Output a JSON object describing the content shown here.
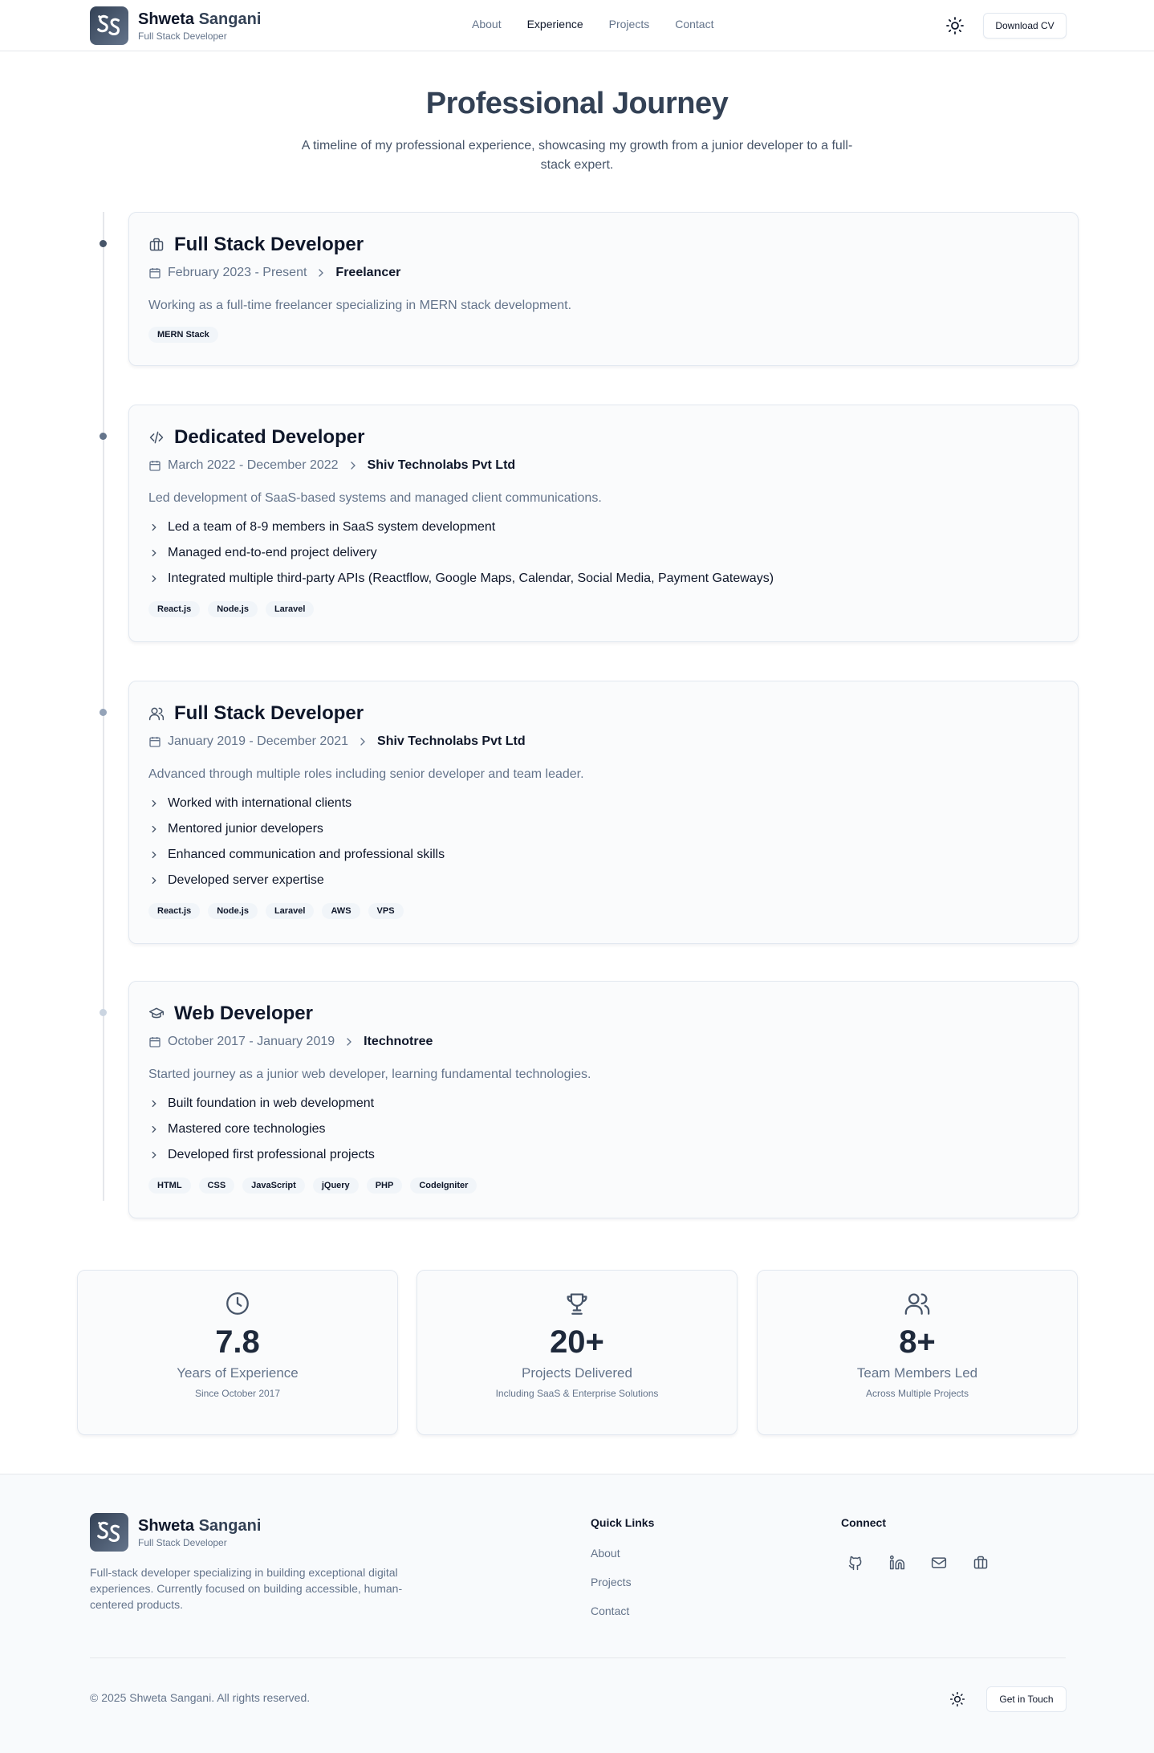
{
  "header": {
    "first_name": "Shweta",
    "last_name": "Sangani",
    "subtitle": "Full Stack Developer",
    "nav": [
      "About",
      "Experience",
      "Projects",
      "Contact"
    ],
    "active_nav": "Experience",
    "download_label": "Download CV"
  },
  "hero": {
    "title": "Professional Journey",
    "subtitle": "A timeline of my professional experience, showcasing my growth from a junior developer to a full-stack expert."
  },
  "experience": [
    {
      "icon": "briefcase-icon",
      "title": "Full Stack Developer",
      "dates": "February 2023 - Present",
      "company": "Freelancer",
      "description": "Working as a full-time freelancer specializing in MERN stack development.",
      "bullets": [],
      "tags": [
        "MERN Stack"
      ]
    },
    {
      "icon": "code-icon",
      "title": "Dedicated Developer",
      "dates": "March 2022 - December 2022",
      "company": "Shiv Technolabs Pvt Ltd",
      "description": "Led development of SaaS-based systems and managed client communications.",
      "bullets": [
        "Led a team of 8-9 members in SaaS system development",
        "Managed end-to-end project delivery",
        "Integrated multiple third-party APIs (Reactflow, Google Maps, Calendar, Social Media, Payment Gateways)"
      ],
      "tags": [
        "React.js",
        "Node.js",
        "Laravel"
      ]
    },
    {
      "icon": "users-icon",
      "title": "Full Stack Developer",
      "dates": "January 2019 - December 2021",
      "company": "Shiv Technolabs Pvt Ltd",
      "description": "Advanced through multiple roles including senior developer and team leader.",
      "bullets": [
        "Worked with international clients",
        "Mentored junior developers",
        "Enhanced communication and professional skills",
        "Developed server expertise"
      ],
      "tags": [
        "React.js",
        "Node.js",
        "Laravel",
        "AWS",
        "VPS"
      ]
    },
    {
      "icon": "graduation-cap-icon",
      "title": "Web Developer",
      "dates": "October 2017 - January 2019",
      "company": "Itechnotree",
      "description": "Started journey as a junior web developer, learning fundamental technologies.",
      "bullets": [
        "Built foundation in web development",
        "Mastered core technologies",
        "Developed first professional projects"
      ],
      "tags": [
        "HTML",
        "CSS",
        "JavaScript",
        "jQuery",
        "PHP",
        "CodeIgniter"
      ]
    }
  ],
  "stats": [
    {
      "icon": "clock-icon",
      "value": "7.8",
      "label": "Years of Experience",
      "sub": "Since October 2017"
    },
    {
      "icon": "trophy-icon",
      "value": "20+",
      "label": "Projects Delivered",
      "sub": "Including SaaS & Enterprise Solutions"
    },
    {
      "icon": "users-icon",
      "value": "8+",
      "label": "Team Members Led",
      "sub": "Across Multiple Projects"
    }
  ],
  "footer": {
    "first_name": "Shweta",
    "last_name": "Sangani",
    "subtitle": "Full Stack Developer",
    "description": "Full-stack developer specializing in building exceptional digital experiences. Currently focused on building accessible, human-centered products.",
    "quick_links_title": "Quick Links",
    "quick_links": [
      "About",
      "Projects",
      "Contact"
    ],
    "connect_title": "Connect",
    "social_icons": [
      "github-icon",
      "linkedin-icon",
      "mail-icon",
      "briefcase-icon"
    ],
    "copyright": "© 2025 Shweta Sangani. All rights reserved.",
    "touch_label": "Get in Touch"
  },
  "colors": {
    "accent": "#334155",
    "text": "#0f172a",
    "muted": "#64748b",
    "border": "#e2e8f0"
  }
}
